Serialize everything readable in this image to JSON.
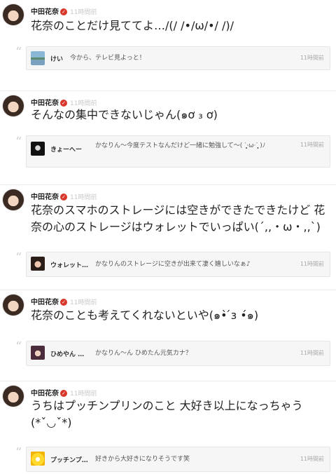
{
  "posts": [
    {
      "author": "中田花奈",
      "time": "11時間前",
      "text": "花奈のことだけ見ててよ…/(/ /•/ω/•/ /)/",
      "reply": {
        "name": "けい",
        "text": "今から、テレビ見よっと！",
        "time": "11時間前"
      }
    },
    {
      "author": "中田花奈",
      "time": "11時間前",
      "text": "そんなの集中できないじゃん(๑ơ ₃ ơ)",
      "reply": {
        "name": "きょーへー",
        "text": "かなりん〜今度テストなんだけど一緒に勉強して〜( ˋ̩̥̥̩̩̥͙·ω·ˊ̩̥̥̩̩̥͙ )ﾉ",
        "time": "11時間前"
      }
    },
    {
      "author": "中田花奈",
      "time": "11時間前",
      "text": "花奈のスマホのストレージには空きができたできたけど 花奈の心のストレージはウォレットでいっぱい(´,,・ω・,,`)",
      "reply": {
        "name": "ウォレット…",
        "text": "かなりんのストレージに空きが出来て凄く嬉しいなぁ♪",
        "time": "11時間前"
      }
    },
    {
      "author": "中田花奈",
      "time": "11時間前",
      "text": "花奈のことも考えてくれないといや(๑•̀ ́ɜ •́๑)",
      "reply": {
        "name": "ひめやん …",
        "text": "かなりん〜ん ひめたん元気カナ？",
        "time": "11時間前"
      }
    },
    {
      "author": "中田花奈",
      "time": "11時間前",
      "text": "うちはプッチンプリンのこと 大好き以上になっちゃう(*ˇ◡ˇ*)",
      "reply": {
        "name": "プッチンプ…",
        "text": "好きから大好きになりそうです笑",
        "time": "11時間前"
      }
    }
  ]
}
